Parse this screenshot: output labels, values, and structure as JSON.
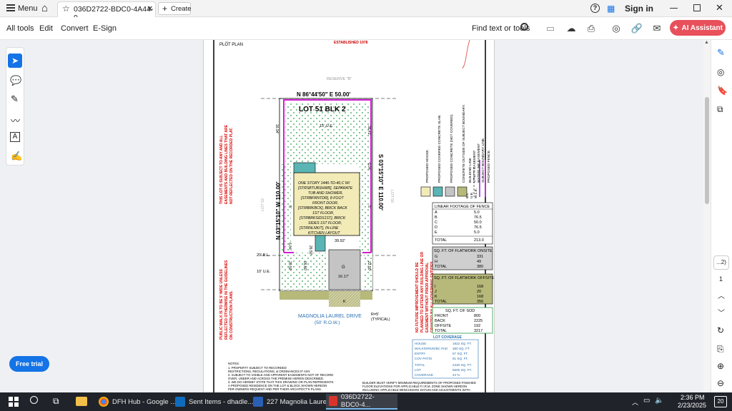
{
  "titlebar": {
    "menu_label": "Menu",
    "tab_title": "036D2722-BDC0-4A44-9...",
    "create_label": "Create",
    "sign_in": "Sign in"
  },
  "toolbar": {
    "menus": [
      "All tools",
      "Edit",
      "Convert",
      "E-Sign"
    ],
    "find_label": "Find text or tools",
    "ai_label": "AI Assistant"
  },
  "sidepanel": {
    "page_indicator": "...2)",
    "page_number": "1"
  },
  "free_trial_label": "Free trial",
  "document": {
    "est_text": "ESTABLISHED 1978",
    "plot_plan": "PLOT PLAN",
    "reserve": "RESERVE \"B\"",
    "top_bearing": "N 86°44'50\" E   50.00'",
    "lot_title": "LOT 51  BLK 2",
    "ue": "15' U.E.",
    "left_bearing": "N 03°15'10\" W   110.00'",
    "right_bearing": "S 03°15'10\" E   110.00'",
    "house_text": [
      "ONE STORY 1446-TD-40,C W/",
      "[STRSBTUBSHWR], SEPARATE",
      "TUB AND SHOWER,",
      "[STRBFRNTDR], 8 FOOT",
      "FRONT DOOR,",
      "[STRBRKBCK], BRICK BACK",
      "1ST FLOOR,",
      "[STRBRKSIDS1ST], BRICK",
      "SIDES 1ST FLOOR,",
      "[STRINLNKIT], IN-LINE",
      "KITCHEN LAYOUT"
    ],
    "house_dim": "39.92'",
    "garage_letter": "G",
    "garage_dim": "16.17'",
    "drive_letter": "K",
    "street_name": "MAGNOLIA LAUREL DRIVE",
    "street_row": "(50' R.O.W.)",
    "radius_note": "R=5'",
    "radius_typical": "(TYPICAL)",
    "setback_20": "20' B.L.",
    "setback_10": "10' U.E.",
    "lot_left": "LOT 52",
    "lot_right": "LOT 50",
    "red_note_left": [
      "THIS LOT IS SUBJECT TO ANY AND ALL",
      "EASEMENTS AND BUILDING LINES THAT ARE",
      "NOT REFLECTED ON THE RECORDED PLAT."
    ],
    "red_note_left2": [
      "PUBLIC WALK IS TO BE 5' WIDE UNLESS",
      "REFLECTED OTHERWISE IN THE GUIDELINES",
      "ON CONSTRUCTION PLANS."
    ],
    "red_note_right": [
      "NO FUTURE IMPROVEMENT SHOULD BE",
      "PLANNED TO EXTEND ANY BUILDING LINE OR",
      "EASEMENT WITHOUT PRIOR APPROVAL",
      "GRANTED BY ALL GOVERNING ENTITIES."
    ],
    "legend_labels": [
      "PROPOSED HOUSE.",
      "PROPOSED COVERED CONCRETE SLAB.",
      "PROPOSED CONCRETE (NOT COVERED).",
      "CONCRETE OUTSIDE OF SUBJECT BOUNDARY.",
      "BUILDING LINE",
      "UTILITY EASEMENT",
      "WATERLINE EASEMENT",
      "SUBJECT BOUNDARY LINE.",
      "PROPOSED FENCE."
    ],
    "legend_abbr": [
      "B.L.",
      "U.E.",
      "W.L.E."
    ],
    "fence_table": {
      "title": "LINEAR FOOTAGE OF FENCE",
      "rows": [
        [
          "A",
          "5.0"
        ],
        [
          "B",
          "76.5"
        ],
        [
          "C",
          "50.0"
        ],
        [
          "D",
          "76.5"
        ],
        [
          "E",
          "5.0"
        ]
      ],
      "total": [
        "TOTAL",
        "213.0"
      ]
    },
    "flatwork_onsite": {
      "title": "SQ. FT. OF FLATWORK ONSITE",
      "rows": [
        [
          "G",
          "331"
        ],
        [
          "H",
          "49"
        ]
      ],
      "total": [
        "TOTAL",
        "380"
      ]
    },
    "flatwork_offsite": {
      "title": "SQ. FT. OF FLATWORK OFFSITE",
      "rows": [
        [
          "I",
          "168"
        ],
        [
          "J",
          "20"
        ],
        [
          "K",
          "168"
        ]
      ],
      "total": [
        "TOTAL",
        "356"
      ]
    },
    "sod_table": {
      "title": "SQ. FT. OF SOD",
      "rows": [
        [
          "FRONT",
          "800"
        ],
        [
          "BACK",
          "2225"
        ],
        [
          "OFFSITE",
          "192"
        ]
      ],
      "total": [
        "TOTAL",
        "3217"
      ]
    },
    "coverage": {
      "title": "LOT COVERAGE",
      "rows": [
        [
          "HOUSE",
          "1922 SQ. FT."
        ],
        [
          "WALK/DRIVE/BC PAD",
          "380 SQ. FT."
        ],
        [
          "ENTRY",
          "57 SQ. FT."
        ],
        [
          "COV PATIO",
          "81 SQ. FT."
        ],
        [
          "TOTAL",
          "2440 SQ. FT."
        ],
        [
          "LOT",
          "5500 SQ. FT."
        ],
        [
          "COVERAGE",
          "44 %"
        ]
      ]
    },
    "notes_title": "NOTES:",
    "notes": [
      "1. PROPERTY SUBJECT TO RECORDED",
      "RESTRICTIONS, REGULATIONS, & ORDINANCES IF ANY.",
      "2. SUBJECT TO VISIBLE AND APPARENT EASEMENTS NOT OF RECORD",
      "OVER, UNDER AND ACROSS THE PREMISE HEREIN DESCRIBED.",
      "3. WE DO HEREBY STATE THAT THIS DRAWING OR PLAN REPRESENTS",
      "A PROPOSED RESIDENCE ON THE LOT & BLOCK SHOWN HEREON",
      "PER OWNERS REQUEST AND PER THEIR ARCHITECT'S PLANS."
    ],
    "builder_note": [
      "BUILDER MUST VERIFY MINIMUM REQUIREMENTS OF PROPOSED FINISHED",
      "FLOOR ELEVATIONS FOR APPLICABLE F.I.R.M. ZONE SHOWN HEREON",
      "INCLUDING APPLICABLE BENCHMARK DATUM AND ADJUSTMENTS WITH"
    ],
    "dims": {
      "d1": "16.94'",
      "d2": "36.41'",
      "d3": "6.04'",
      "d4": "6.04'",
      "d5": "20.50'",
      "d6": "22.50'",
      "d7": "26.50'",
      "d8": "26.50'",
      "d9": "5'",
      "d10": "5'"
    }
  },
  "taskbar": {
    "apps": [
      "DFH Hub - Google ...",
      "Sent Items - dhadle...",
      "227 Magnolia Laure...",
      "036D2722-BDC0-4..."
    ],
    "time": "2:36 PM",
    "date": "2/23/2025",
    "notif": "20"
  }
}
